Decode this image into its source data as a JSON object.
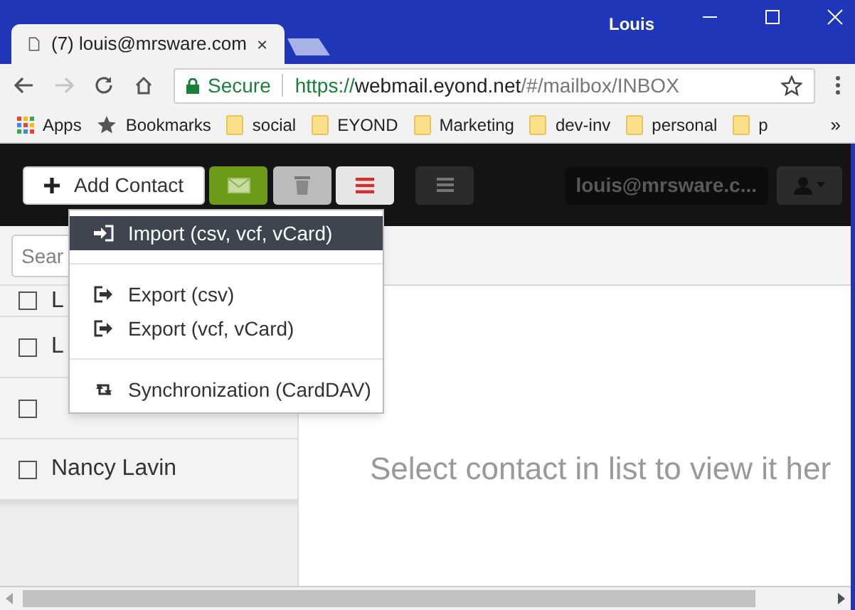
{
  "window": {
    "profile": "Louis"
  },
  "tabs": [
    {
      "title": "(7) louis@mrsware.com",
      "selected": true
    }
  ],
  "address_bar": {
    "secure_label": "Secure",
    "url_scheme": "https://",
    "url_host": "webmail.eyond.net",
    "url_path": "/#/mailbox/INBOX"
  },
  "bookmarks": [
    {
      "kind": "apps",
      "label": "Apps"
    },
    {
      "kind": "star",
      "label": "Bookmarks"
    },
    {
      "kind": "folder",
      "label": "social"
    },
    {
      "kind": "folder",
      "label": "EYOND"
    },
    {
      "kind": "folder",
      "label": "Marketing"
    },
    {
      "kind": "folder",
      "label": "dev-inv"
    },
    {
      "kind": "folder",
      "label": "personal"
    },
    {
      "kind": "folder",
      "label": "p"
    }
  ],
  "bookmarks_overflow": "»",
  "toolbar": {
    "add_contact": "Add Contact",
    "account": "louis@mrsware.c..."
  },
  "search": {
    "placeholder": "Sear"
  },
  "contacts": [
    {
      "name": "L",
      "checked": false
    },
    {
      "name": "L",
      "checked": false
    },
    {
      "checked": false
    },
    {
      "name": "Nancy Lavin",
      "checked": false
    }
  ],
  "menu": [
    {
      "kind": "import",
      "label": "Import (csv, vcf, vCard)",
      "selected": true
    },
    {
      "kind": "divider"
    },
    {
      "kind": "export",
      "label": "Export (csv)",
      "selected": false
    },
    {
      "kind": "export",
      "label": "Export (vcf, vCard)",
      "selected": false
    },
    {
      "kind": "divider"
    },
    {
      "kind": "sync",
      "label": "Synchronization (CardDAV)",
      "selected": false
    }
  ],
  "empty_message": "Select contact in list to view it her"
}
